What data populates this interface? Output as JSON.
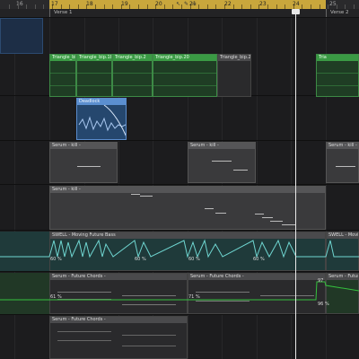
{
  "ruler": {
    "numbers": [
      {
        "label": "16",
        "dark": true
      },
      {
        "label": "17",
        "dark": false
      },
      {
        "label": "18",
        "dark": false
      },
      {
        "label": "19",
        "dark": false
      },
      {
        "label": "20",
        "dark": false
      },
      {
        "label": "21",
        "dark": false
      },
      {
        "label": "22",
        "dark": false
      },
      {
        "label": "23",
        "dark": false
      },
      {
        "label": "24",
        "dark": false
      },
      {
        "label": "25",
        "dark": true
      }
    ],
    "cycle_color": "#c9a73c"
  },
  "markers": {
    "verse1": "Verse 1",
    "verse2": "Verse 2"
  },
  "regions": {
    "triangle": [
      "Triangle_bip.23",
      "Triangle_bip.18",
      "Triangle_bip.2",
      "Triangle_bip.20",
      "Triangle_bip.21"
    ],
    "triangle_right": "Tria",
    "deadlock": "Deadlock",
    "serum_kill_a": "Serum - kill -",
    "serum_kill_b": "Serum - kill -",
    "serum_kill_c": "Serum - kill -",
    "serum_kill_long": "Serum - kill -",
    "swell_a": "SWELL - Moving Future Bass",
    "swell_b": "SWELL - Moving",
    "serum_future_a": "Serum - Future Chords -",
    "serum_future_b": "Serum - Future Chords -",
    "serum_future_c": "Serum - Future Chords -",
    "serum_future_d": "Serum - Future Chords -"
  },
  "automation": {
    "pct_a": "60 %",
    "pct_b": "61 %",
    "pct_c": "71 %",
    "pct_d": "97",
    "pct_e": "96 %"
  },
  "colors": {
    "audio_green": "#3a9a44",
    "audio_blue": "#5b8fd0",
    "automation": "#6fd5d0",
    "automation_green": "#35c23e",
    "playhead": "#e8e8e8"
  }
}
